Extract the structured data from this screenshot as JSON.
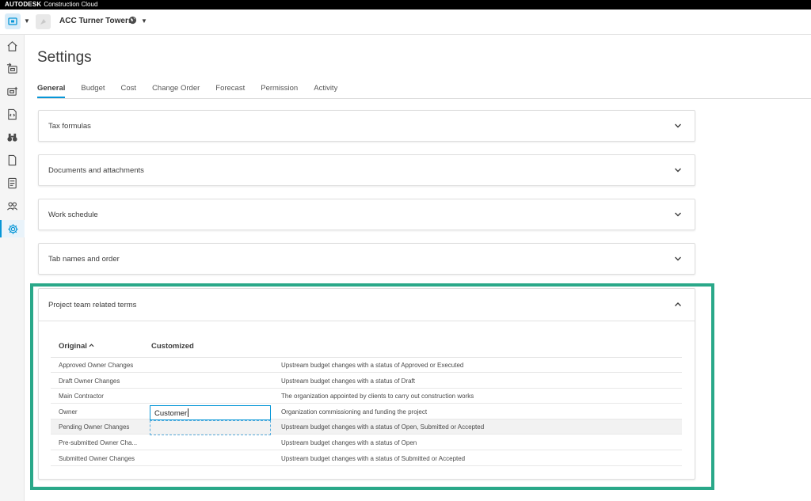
{
  "topbar": {
    "brand": "AUTODESK",
    "product": "Construction Cloud"
  },
  "header": {
    "project_name": "ACC Turner Towers"
  },
  "icons": {
    "module": "module-switcher-icon",
    "home": "home-icon",
    "nav2": "box-arrow-icon",
    "nav3": "camera-box-icon",
    "nav4": "code-doc-icon",
    "nav5": "binoculars-icon",
    "nav6": "document-icon",
    "nav7": "checklist-icon",
    "nav8": "people-icon",
    "settings": "gear-icon"
  },
  "colors": {
    "accent": "#0696d7",
    "highlight": "#2aa889"
  },
  "page": {
    "title": "Settings"
  },
  "tabs": [
    {
      "label": "General",
      "active": true
    },
    {
      "label": "Budget"
    },
    {
      "label": "Cost"
    },
    {
      "label": "Change Order"
    },
    {
      "label": "Forecast"
    },
    {
      "label": "Permission"
    },
    {
      "label": "Activity"
    }
  ],
  "panels": [
    {
      "title": "Tax formulas"
    },
    {
      "title": "Documents and attachments"
    },
    {
      "title": "Work schedule"
    },
    {
      "title": "Tab names and order"
    }
  ],
  "terms_panel": {
    "title": "Project team related terms",
    "columns": {
      "original": "Original",
      "customized": "Customized"
    },
    "rows": [
      {
        "original": "Approved Owner Changes",
        "customized": "",
        "description": "Upstream budget changes with a status of Approved or Executed"
      },
      {
        "original": "Draft Owner Changes",
        "customized": "",
        "description": "Upstream budget changes with a status of Draft"
      },
      {
        "original": "Main Contractor",
        "customized": "",
        "description": "The organization appointed by clients to carry out construction works"
      },
      {
        "original": "Owner",
        "customized": "Customer",
        "description": "Organization commissioning and funding the project"
      },
      {
        "original": "Pending Owner Changes",
        "customized": "",
        "description": "Upstream budget changes with a status of Open, Submitted or Accepted"
      },
      {
        "original": "Pre-submitted Owner Cha...",
        "customized": "",
        "description": "Upstream budget changes with a status of Open"
      },
      {
        "original": "Submitted Owner Changes",
        "customized": "",
        "description": "Upstream budget changes with a status of Submitted or Accepted"
      }
    ]
  }
}
